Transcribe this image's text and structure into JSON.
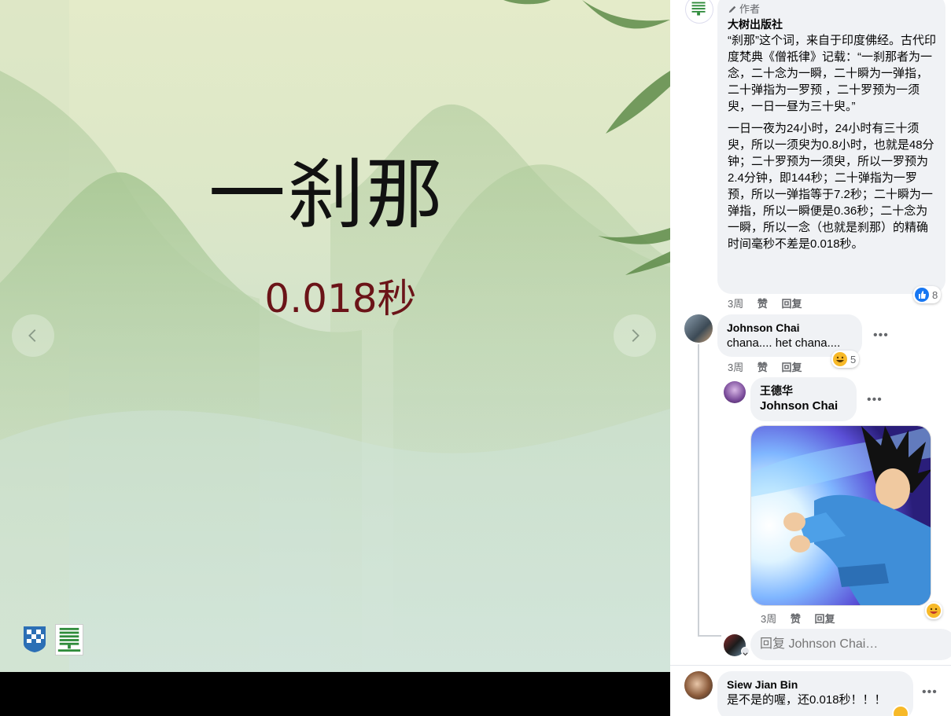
{
  "slide": {
    "title": "一刹那",
    "subtitle": "0.018秒"
  },
  "viewer": {
    "prev_icon": "chevron-left-icon",
    "next_icon": "chevron-right-icon"
  },
  "post": {
    "author_badge": "作者",
    "author_name": "大树出版社",
    "paragraph1": "“刹那”这个词，来自于印度佛经。古代印度梵典《僧祇律》记载：“一刹那者为一念，二十念为一瞬，二十瞬为一弹指，二十弹指为一罗预 ，二十罗预为一须臾，一日一昼为三十臾。”",
    "paragraph2": "一日一夜为24小时，24小时有三十须臾，所以一须臾为0.8小时，也就是48分钟；二十罗预为一须臾，所以一罗预为2.4分钟，即144秒；二十弹指为一罗预，所以一弹指等于7.2秒；二十瞬为一弹指，所以一瞬便是0.36秒；二十念为一瞬，所以一念（也就是刹那）的精确时间毫秒不差是0.018秒。",
    "time": "3周",
    "like": "赞",
    "reply": "回复",
    "reaction_count": "8"
  },
  "comments": [
    {
      "name": "Johnson Chai",
      "text": "chana.... het chana....",
      "time": "3周",
      "like": "赞",
      "reply": "回复",
      "reaction_count": "5"
    }
  ],
  "reply": {
    "name": "王德华",
    "mention": "Johnson Chai",
    "time": "3周",
    "like": "赞",
    "reply": "回复"
  },
  "reply_box": {
    "placeholder": "回复 Johnson Chai…"
  },
  "comment2": {
    "name": "Siew Jian Bin",
    "text": "是不是的喔，还0.018秒！！！"
  },
  "colors": {
    "bubble_bg": "#f0f2f5",
    "like_blue": "#1877f2",
    "subtitle_red": "#6b1418",
    "meta_gray": "#65676b"
  }
}
